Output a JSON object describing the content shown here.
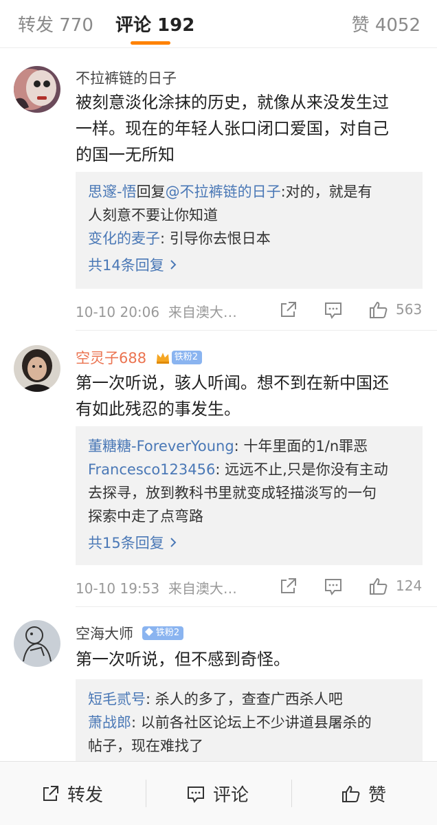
{
  "tabs": {
    "repost": "转发 770",
    "comment": "评论 192",
    "like": "赞 4052"
  },
  "comments": [
    {
      "user": "不拉裤链的日子",
      "text_lines": [
        "被刻意淡化涂抹的历史，就像从来没发生过",
        "一样。现在的年轻人张口闭口爱国，对自己",
        "的国一无所知"
      ],
      "replies": [
        {
          "who": "思邃-悟",
          "mid": "回复",
          "at": "@不拉裤链的日子",
          "text": ":对的，就是有",
          "cont": "人刻意不要让你知道"
        },
        {
          "who": "变化的麦子",
          "text": ": 引导你去恨日本"
        }
      ],
      "more": "共14条回复",
      "time": "10-10 20:06",
      "source": "来自澳大…",
      "likes": "563"
    },
    {
      "user": "空灵子688",
      "badge": "铁粉2",
      "text_lines": [
        "第一次听说，骇人听闻。想不到在新中国还",
        "有如此残忍的事发生。"
      ],
      "replies": [
        {
          "who": "董糖糖-ForeverYoung",
          "text": ": 十年里面的1/n罪恶"
        },
        {
          "who": "Francesco123456",
          "text": ": 远远不止,只是你没有主动",
          "cont": "去探寻，放到教科书里就变成轻描淡写的一句",
          "cont2": "探索中走了点弯路"
        }
      ],
      "more": "共15条回复",
      "time": "10-10 19:53",
      "source": "来自澳大…",
      "likes": "124"
    },
    {
      "user": "空海大师",
      "badge": "铁粉2",
      "text_lines": [
        "第一次听说，但不感到奇怪。"
      ],
      "replies": [
        {
          "who": "短毛贰号",
          "text": ": 杀人的多了，查查广西杀人吧"
        },
        {
          "who": "萧战郎",
          "text": ": 以前各社区论坛上不少讲道县屠杀的",
          "cont": "帖子，现在难找了"
        }
      ]
    }
  ],
  "bottom": {
    "repost": "转发",
    "comment": "评论",
    "like": "赞"
  },
  "colors": {
    "accent": "#ff8200",
    "link": "#4a78b6",
    "username_highlight": "#eb7350",
    "badge": "#8ab4f0"
  }
}
